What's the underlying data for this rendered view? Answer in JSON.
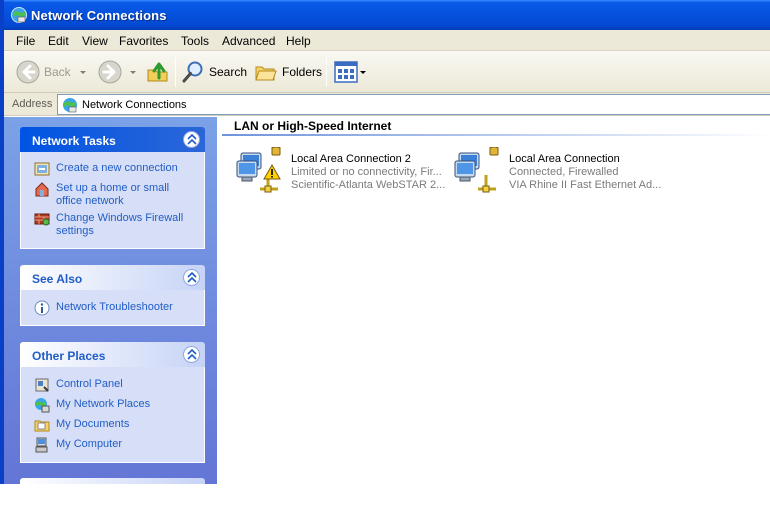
{
  "window": {
    "title": "Network Connections"
  },
  "menu": [
    "File",
    "Edit",
    "View",
    "Favorites",
    "Tools",
    "Advanced",
    "Help"
  ],
  "toolbar": {
    "back_label": "Back",
    "search_label": "Search",
    "folders_label": "Folders"
  },
  "address": {
    "label": "Address",
    "value": "Network Connections"
  },
  "sidebar": {
    "network_tasks": {
      "title": "Network Tasks",
      "items": [
        {
          "label": "Create a new connection",
          "icon": "new-connection-icon"
        },
        {
          "label": "Set up a home or small office network",
          "icon": "home-network-icon"
        },
        {
          "label": "Change Windows Firewall settings",
          "icon": "firewall-icon"
        }
      ]
    },
    "see_also": {
      "title": "See Also",
      "items": [
        {
          "label": "Network Troubleshooter",
          "icon": "info-icon"
        }
      ]
    },
    "other_places": {
      "title": "Other Places",
      "items": [
        {
          "label": "Control Panel",
          "icon": "control-panel-icon"
        },
        {
          "label": "My Network Places",
          "icon": "network-places-icon"
        },
        {
          "label": "My Documents",
          "icon": "documents-folder-icon"
        },
        {
          "label": "My Computer",
          "icon": "my-computer-icon"
        }
      ]
    }
  },
  "content": {
    "group_title": "LAN or High-Speed Internet",
    "connections": [
      {
        "name": "Local Area Connection 2",
        "status": "Limited or no connectivity, Fir...",
        "device": "Scientific-Atlanta WebSTAR 2...",
        "warning": true
      },
      {
        "name": "Local Area Connection",
        "status": "Connected, Firewalled",
        "device": "VIA Rhine II Fast Ethernet Ad...",
        "warning": false
      }
    ]
  },
  "colors": {
    "titlebar": "#0553e0",
    "sidebar": "#7ba2e7",
    "link": "#215dc6",
    "group_line": "#6f94dc"
  }
}
